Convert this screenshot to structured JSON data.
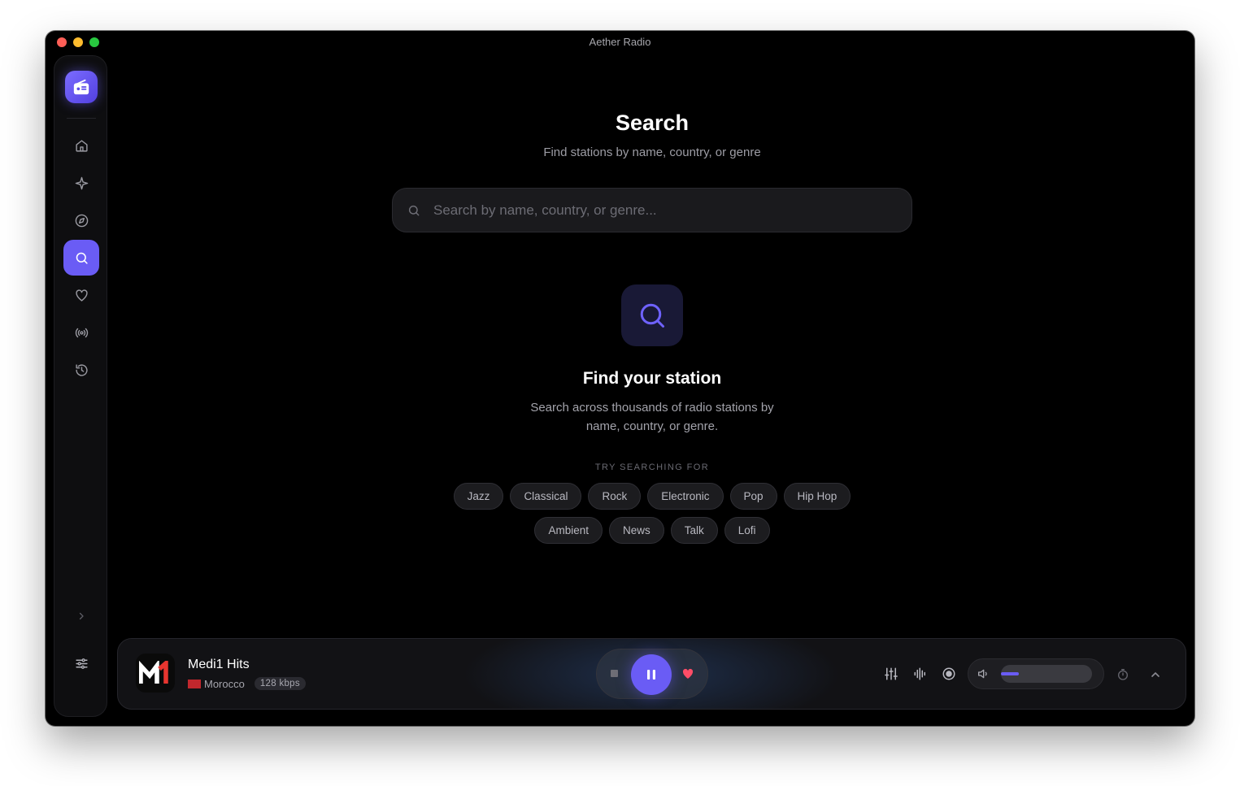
{
  "window": {
    "title": "Aether Radio"
  },
  "sidebar": {
    "items": [
      {
        "name": "home",
        "active": false
      },
      {
        "name": "sparkle",
        "active": false
      },
      {
        "name": "compass",
        "active": false
      },
      {
        "name": "search",
        "active": true
      },
      {
        "name": "heart",
        "active": false
      },
      {
        "name": "broadcast",
        "active": false
      },
      {
        "name": "history",
        "active": false
      }
    ]
  },
  "search": {
    "title": "Search",
    "subtitle": "Find stations by name, country, or genre",
    "placeholder": "Search by name, country, or genre...",
    "value": ""
  },
  "empty_state": {
    "title": "Find your station",
    "description_line1": "Search across thousands of radio stations by",
    "description_line2": "name, country, or genre."
  },
  "suggestions": {
    "label": "TRY SEARCHING FOR",
    "row1": [
      "Jazz",
      "Classical",
      "Rock",
      "Electronic",
      "Pop",
      "Hip Hop"
    ],
    "row2": [
      "Ambient",
      "News",
      "Talk",
      "Lofi"
    ]
  },
  "player": {
    "station": "Medi1 Hits",
    "country": "Morocco",
    "bitrate": "128 kbps",
    "playing": true,
    "favorited": true,
    "volume": 0.2
  },
  "colors": {
    "accent": "#6a5cf5",
    "favorite": "#ff4d67",
    "background": "#000000"
  }
}
